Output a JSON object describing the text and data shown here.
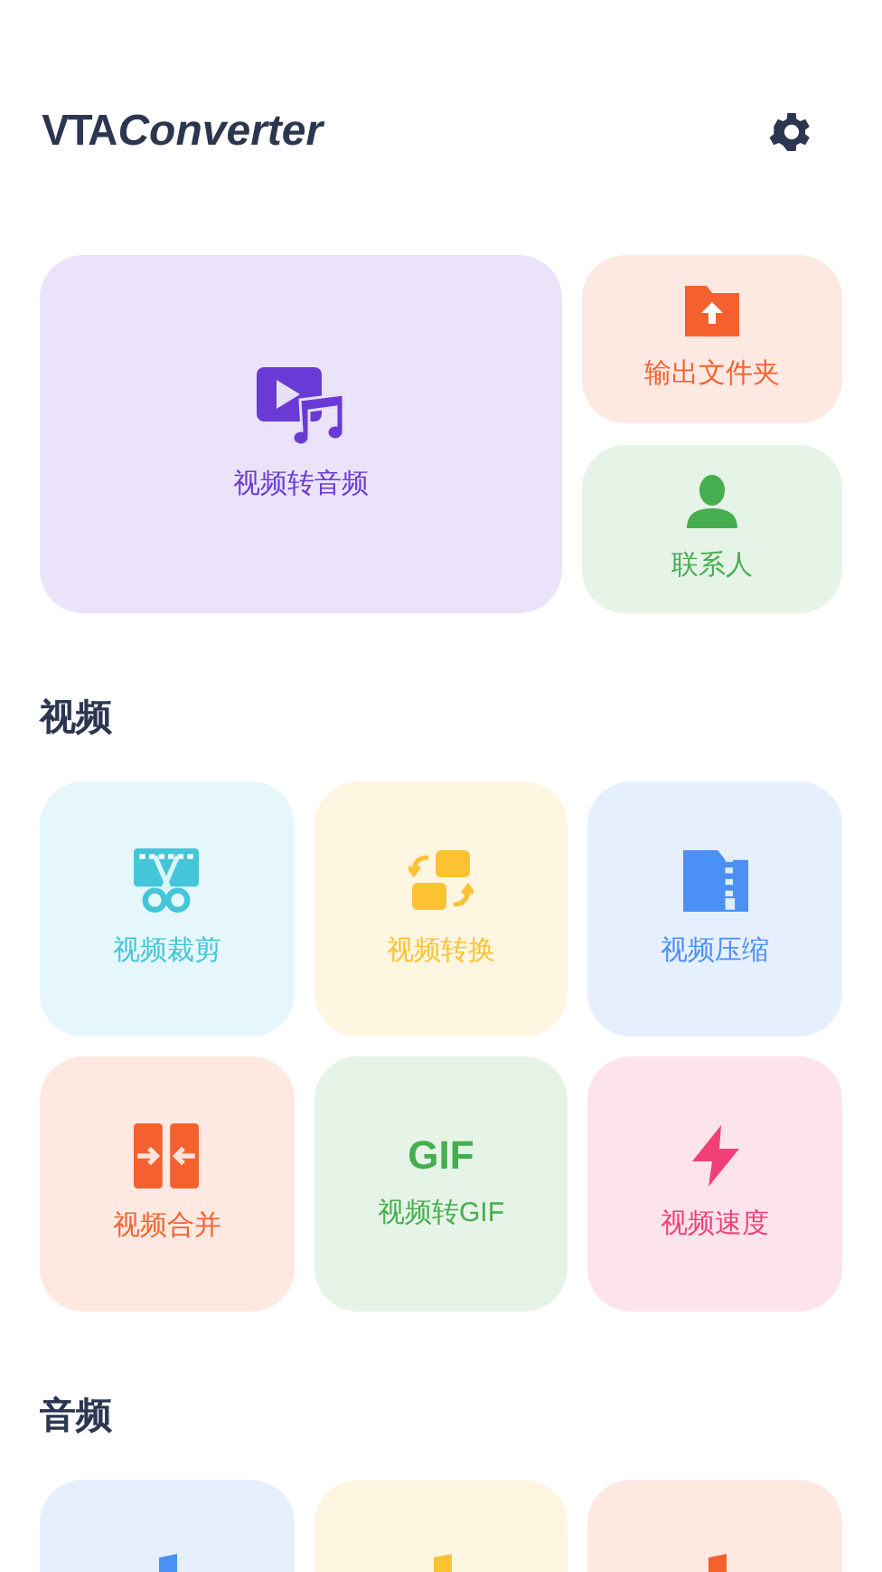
{
  "header": {
    "logo_prefix": "VTA",
    "logo_suffix": "Converter"
  },
  "featured": {
    "label": "视频转音频",
    "color": "#6a3ad6",
    "kind": "video-audio"
  },
  "side": [
    {
      "label": "输出文件夹",
      "color": "#f4612e",
      "kind": "folder"
    },
    {
      "label": "联系人",
      "color": "#46ae4f",
      "kind": "person"
    }
  ],
  "sections": [
    {
      "title": "视频",
      "tiles": [
        {
          "label": "视频裁剪",
          "color": "#45c5d8",
          "kind": "cut"
        },
        {
          "label": "视频转换",
          "color": "#fcc232",
          "kind": "convert"
        },
        {
          "label": "视频压缩",
          "color": "#4a90f5",
          "kind": "zip"
        },
        {
          "label": "视频合并",
          "color": "#f4612e",
          "kind": "merge"
        },
        {
          "label": "视频转GIF",
          "color": "#46ae4f",
          "kind": "gif",
          "icon_text": "GIF"
        },
        {
          "label": "视频速度",
          "color": "#f33f78",
          "kind": "speed"
        }
      ]
    },
    {
      "title": "音频",
      "tiles": [
        {
          "color": "#4a90f5",
          "kind": "note"
        },
        {
          "color": "#fcc232",
          "kind": "note"
        },
        {
          "color": "#f4612e",
          "kind": "note"
        }
      ]
    }
  ]
}
